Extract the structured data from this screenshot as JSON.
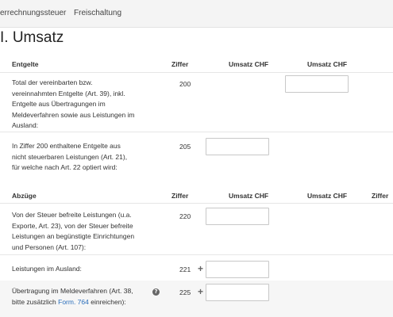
{
  "nav": {
    "tabs": [
      {
        "label": "errechnungssteuer"
      },
      {
        "label": "Freischaltung"
      }
    ]
  },
  "page_title": "I. Umsatz",
  "section1": {
    "headers": {
      "entgelte": "Entgelte",
      "ziffer": "Ziffer",
      "umsatz1": "Umsatz CHF",
      "umsatz2": "Umsatz CHF"
    },
    "rows": [
      {
        "description": "Total der vereinbarten bzw. vereinnahmten Entgelte (Art. 39), inkl. Entgelte aus Übertragungen im Meldeverfahren sowie aus Leistungen im Ausland:",
        "ziffer": "200"
      },
      {
        "description": "In Ziffer 200 enthaltene Entgelte aus nicht steuerbaren Leistungen (Art. 21), für welche nach Art. 22 optiert wird:",
        "ziffer": "205"
      }
    ]
  },
  "section2": {
    "headers": {
      "abzuege": "Abzüge",
      "ziffer": "Ziffer",
      "umsatz1": "Umsatz CHF",
      "umsatz2": "Umsatz CHF",
      "ziffer2": "Ziffer"
    },
    "rows": [
      {
        "description": "Von der Steuer befreite Leistungen (u.a. Exporte, Art. 23), von der Steuer befreite Leistungen an begünstigte Einrichtungen und Personen (Art. 107):",
        "ziffer": "220"
      },
      {
        "description": "Leistungen im Ausland:",
        "ziffer": "221",
        "prefix": "+"
      },
      {
        "description_prefix": "Übertragung im Meldeverfahren (Art. 38, bitte zusätzlich ",
        "link": "Form. 764",
        "description_suffix": " einreichen):",
        "ziffer": "225",
        "prefix": "+",
        "help_icon": "question-circle-icon"
      }
    ]
  }
}
